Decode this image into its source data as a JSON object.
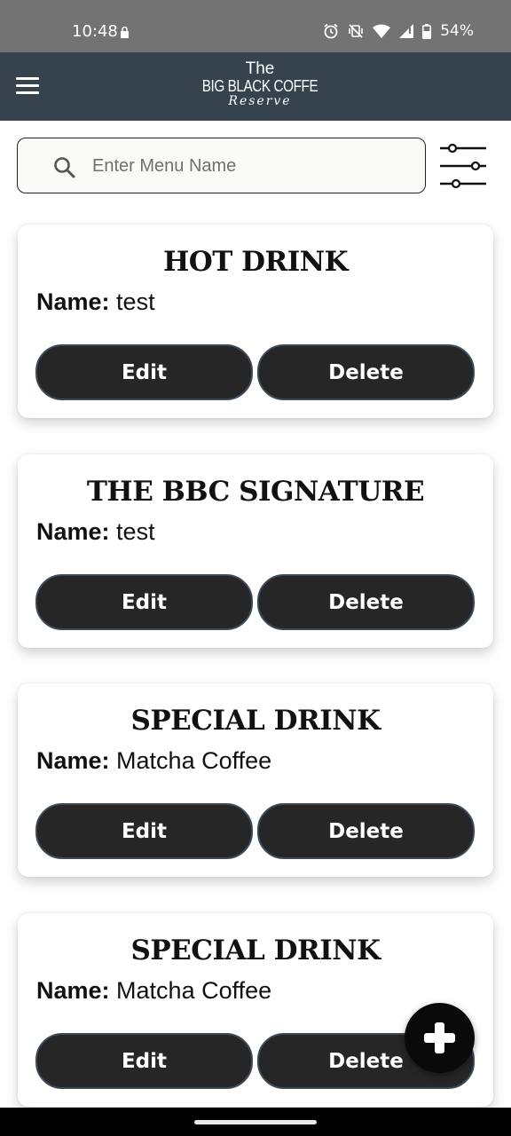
{
  "status_bar": {
    "time": "10:48",
    "battery": "54%",
    "icons": [
      "lock-icon",
      "alarm-icon",
      "vibrate-off-icon",
      "wifi-icon",
      "signal-icon",
      "battery-icon"
    ]
  },
  "header": {
    "logo": {
      "line1": "The",
      "line2": "BIG BLACK COFFE",
      "line3": "Reserve"
    },
    "menu_icon": "hamburger-icon"
  },
  "search": {
    "placeholder": "Enter Menu Name",
    "value": ""
  },
  "filter_icon": "sliders-icon",
  "cards": [
    {
      "category": "HOT DRINK",
      "name_label": "Name:",
      "name": "test",
      "edit_label": "Edit",
      "delete_label": "Delete"
    },
    {
      "category": "THE BBC SIGNATURE",
      "name_label": "Name:",
      "name": "test",
      "edit_label": "Edit",
      "delete_label": "Delete"
    },
    {
      "category": "SPECIAL DRINK",
      "name_label": "Name:",
      "name": "Matcha Coffee",
      "edit_label": "Edit",
      "delete_label": "Delete"
    },
    {
      "category": "SPECIAL DRINK",
      "name_label": "Name:",
      "name": "Matcha Coffee",
      "edit_label": "Edit",
      "delete_label": "Delete"
    }
  ],
  "fab_icon": "plus-icon",
  "colors": {
    "status_bar": "#737373",
    "header": "#36434e",
    "button": "#262626",
    "button_border": "#3c4a58",
    "fab": "#0a0a0a"
  }
}
